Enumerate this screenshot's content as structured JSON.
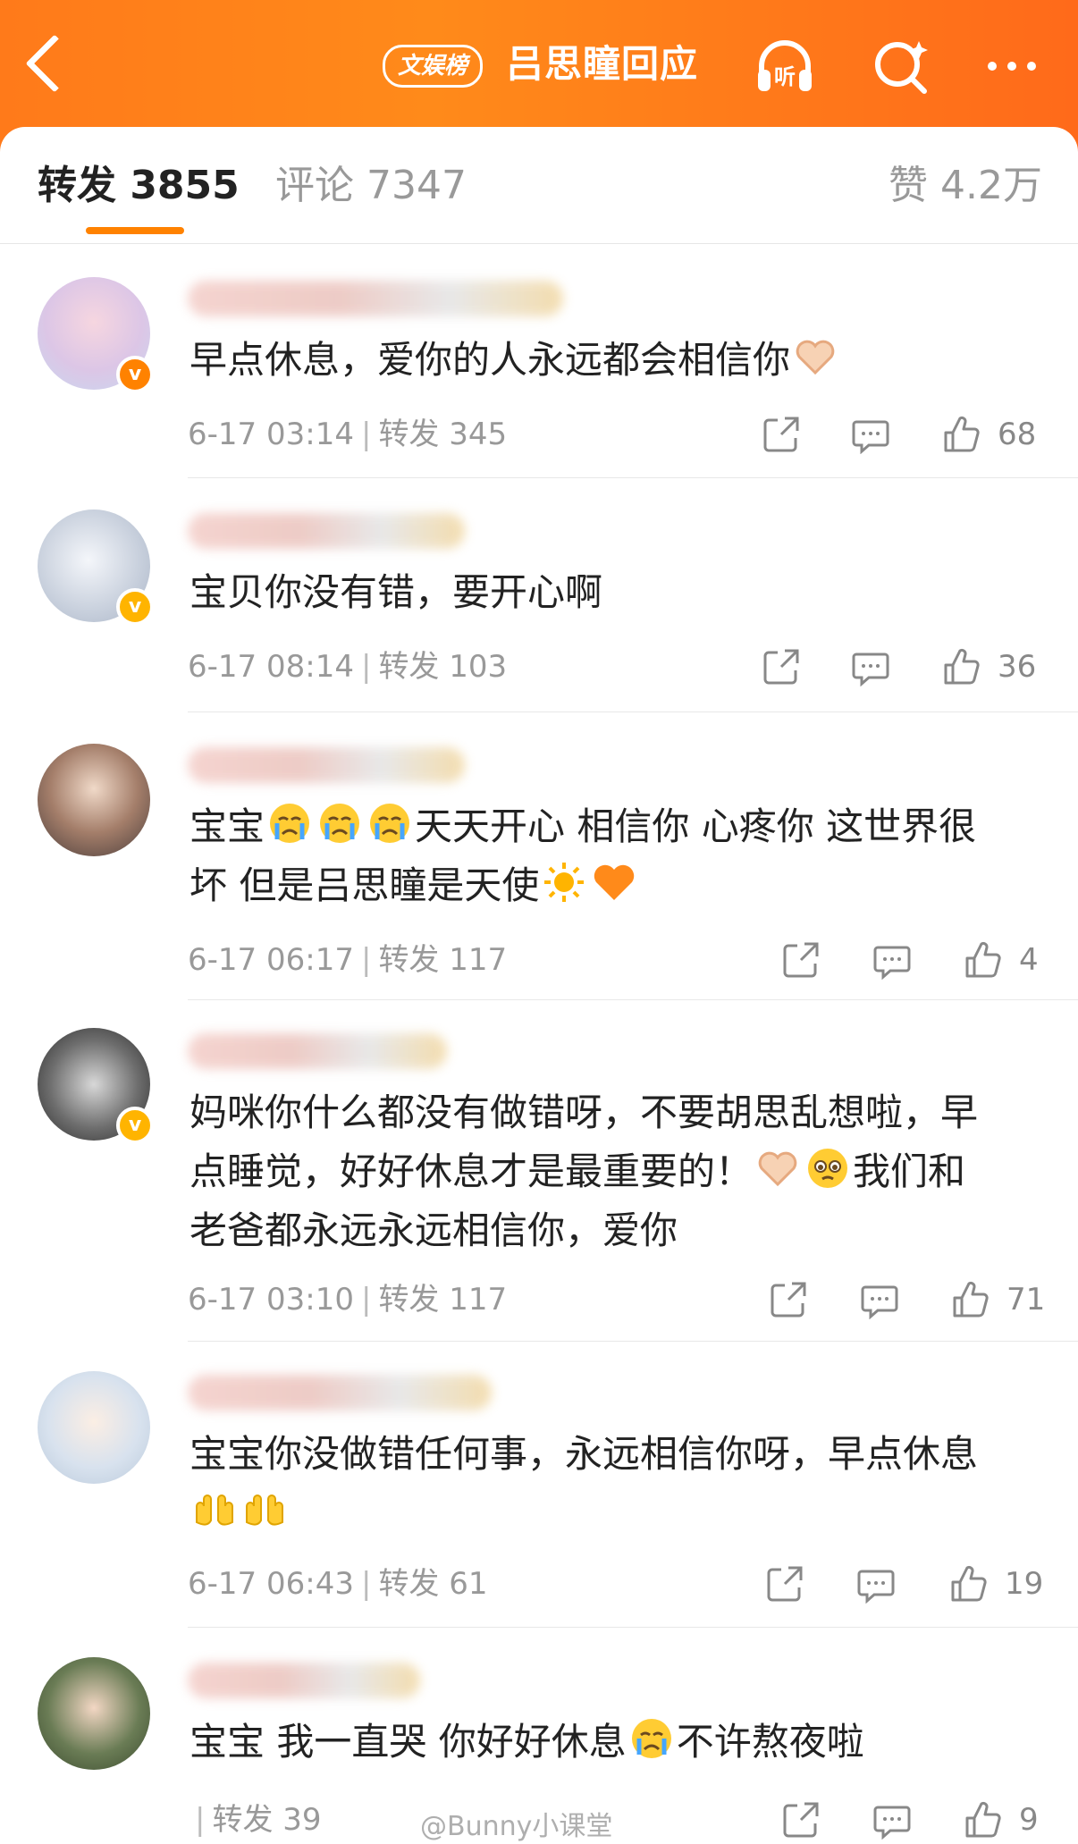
{
  "header": {
    "badge": "文娱榜",
    "title": "吕思瞳回应"
  },
  "tabs": {
    "repost": "转发 3855",
    "comment": "评论 7347",
    "like": "赞 4.2万"
  },
  "comments": [
    {
      "text": "早点休息，爱你的人永远都会相信你",
      "date": "6-17 03:14",
      "repost": "转发 345",
      "likes": "68"
    },
    {
      "text": "宝贝你没有错，要开心啊",
      "date": "6-17 08:14",
      "repost": "转发 103",
      "likes": "36"
    },
    {
      "text_a": "宝宝",
      "text_b": "天天开心 相信你 心疼你 这世界很",
      "text_c": "坏 但是吕思瞳是天使",
      "date": "6-17 06:17",
      "repost": "转发 117",
      "likes": "4"
    },
    {
      "text_a": "妈咪你什么都没有做错呀，不要胡思乱想啦，早",
      "text_b": "点睡觉，好好休息才是最重要的！",
      "text_c": "我们和",
      "text_d": "老爸都永远永远相信你，爱你",
      "date": "6-17 03:10",
      "repost": "转发 117",
      "likes": "71"
    },
    {
      "text_a": "宝宝你没做错任何事，永远相信你呀，早点休息",
      "date": "6-17 06:43",
      "repost": "转发 61",
      "likes": "19"
    },
    {
      "text_a": "宝宝 我一直哭 你好好休息",
      "text_b": "不许熬夜啦",
      "repost": "转发 39",
      "likes": "9"
    }
  ],
  "watermark": "@Bunny小课堂",
  "colors": {
    "accent": "#ff8200",
    "header": "#ff7a1a"
  }
}
